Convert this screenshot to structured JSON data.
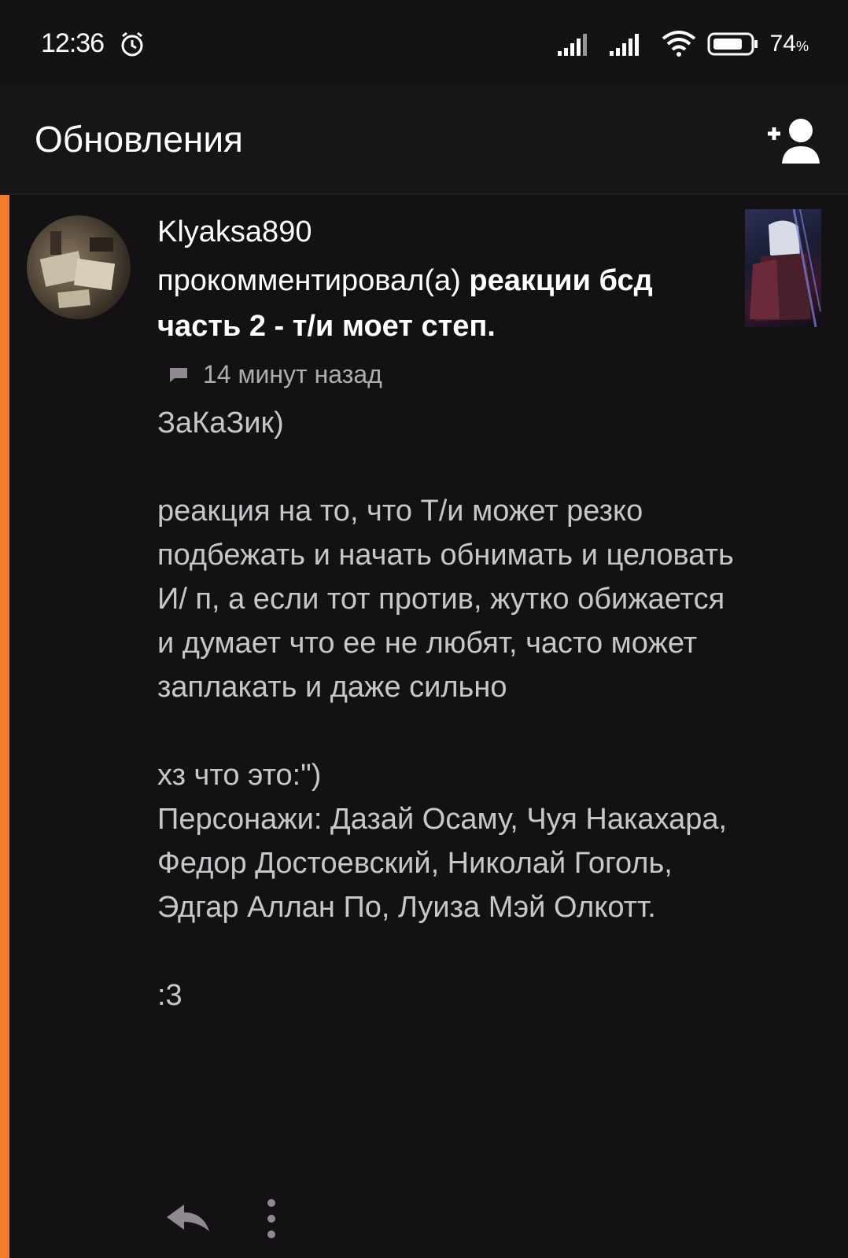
{
  "status_bar": {
    "time": "12:36",
    "battery": "74",
    "battery_unit": "%"
  },
  "header": {
    "title": "Обновления"
  },
  "notification": {
    "username": "Klyaksa890",
    "action": "прокомментировал(а)",
    "target_title": "реакции бсд часть 2 - т/и моет степ.",
    "time_ago": "14 минут назад",
    "comment": {
      "line1": "ЗаКаЗик)",
      "para2": "реакция на то, что Т/и может резко подбежать и начать обнимать и целовать И/ п, а если тот против, жутко обижается и думает что ее не любят, часто может заплакать и даже сильно",
      "para3a": "хз что это:\")",
      "para3b": "Персонажи: Дазай Осаму, Чуя Накахара, Федор Достоевский, Николай Гоголь, Эдгар Аллан По, Луиза Мэй Олкотт.",
      "para4": ":3"
    }
  },
  "colors": {
    "accent": "#f47b2e",
    "background": "#131114",
    "text_secondary": "#c9c6ca"
  }
}
